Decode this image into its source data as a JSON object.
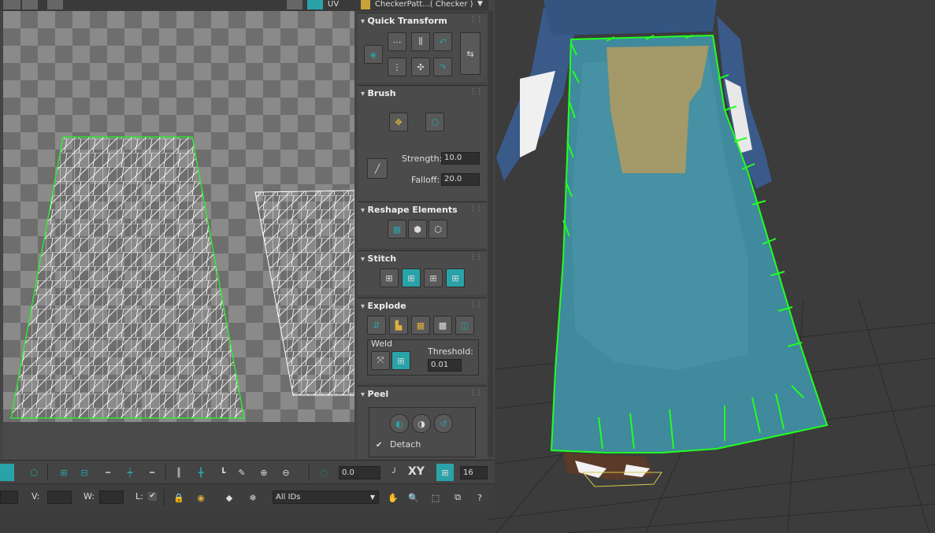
{
  "uv_editor": {
    "topbar": {
      "texture_dropdown": "CheckerPatt...( Checker )",
      "uv_label": "UV"
    }
  },
  "panel": {
    "quick_transform": {
      "title": "Quick Transform"
    },
    "brush": {
      "title": "Brush",
      "strength_label": "Strength:",
      "strength_value": "10.0",
      "falloff_label": "Falloff:",
      "falloff_value": "20.0"
    },
    "reshape": {
      "title": "Reshape Elements"
    },
    "stitch": {
      "title": "Stitch"
    },
    "explode": {
      "title": "Explode",
      "weld_label": "Weld",
      "threshold_label": "Threshold:",
      "threshold_value": "0.01"
    },
    "peel": {
      "title": "Peel",
      "detach_label": "Detach",
      "detach_checked": true
    }
  },
  "toolbar1": {
    "angle_value": "0.0",
    "xy_label": "XY",
    "snap_value": "16"
  },
  "toolbar2": {
    "v_label": "V:",
    "w_label": "W:",
    "l_label": "L:",
    "ids_dropdown": "All IDs"
  },
  "colors": {
    "accent": "#2aa3a8",
    "selection_edge": "#22ff22",
    "cloak": "#3f8a9c"
  }
}
